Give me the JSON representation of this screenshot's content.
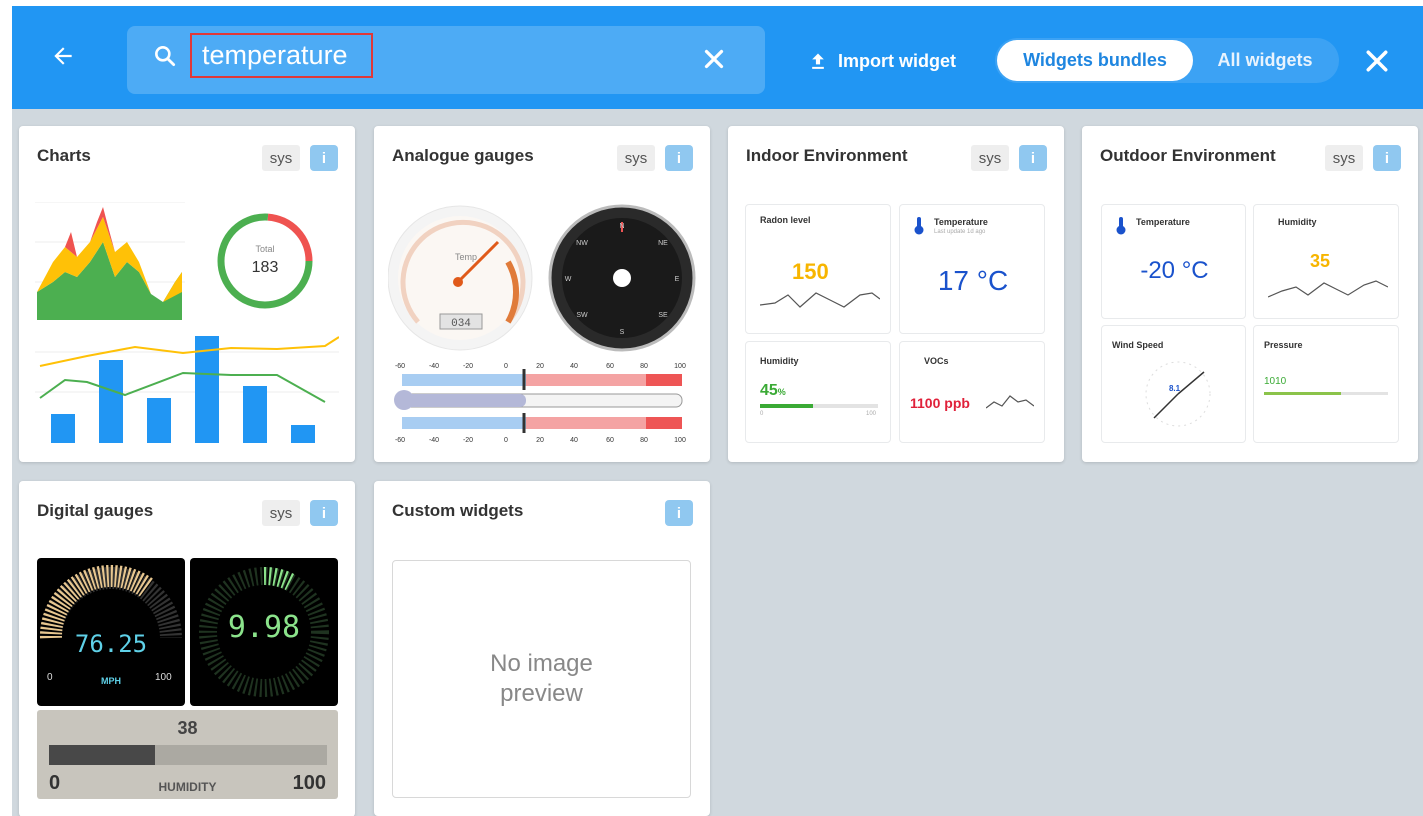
{
  "header": {
    "search_value": "temperature",
    "import_label": "Import widget",
    "toggle_active": "Widgets bundles",
    "toggle_inactive": "All widgets"
  },
  "icons": {
    "back": "arrow-left-icon",
    "search": "search-icon",
    "clear": "close-icon",
    "import": "upload-icon",
    "close": "close-icon"
  },
  "colors": {
    "header_bg": "#2196f3",
    "content_bg": "#d0d8de",
    "search_highlight": "#e03838",
    "info_badge": "#90c8f0"
  },
  "cards": [
    {
      "title": "Charts",
      "sys": "sys",
      "info": "i"
    },
    {
      "title": "Analogue gauges",
      "sys": "sys",
      "info": "i"
    },
    {
      "title": "Indoor Environment",
      "sys": "sys",
      "info": "i"
    },
    {
      "title": "Outdoor Environment",
      "sys": "sys",
      "info": "i"
    },
    {
      "title": "Digital gauges",
      "sys": "sys",
      "info": "i"
    },
    {
      "title": "Custom widgets",
      "info": "i",
      "no_preview": "No image preview"
    }
  ],
  "charts_preview": {
    "donut_label": "Total",
    "donut_value": "183"
  },
  "analogue_preview": {
    "gauge_label": "Temp",
    "gauge_readout": "034",
    "compass": [
      "N",
      "NE",
      "E",
      "SE",
      "S",
      "SW",
      "W",
      "NW"
    ],
    "scale": [
      "-60",
      "-40",
      "-20",
      "0",
      "20",
      "40",
      "60",
      "80",
      "100"
    ]
  },
  "indoor_preview": {
    "radon_label": "Radon level",
    "radon_value": "150",
    "temp_label": "Temperature",
    "temp_sub": "Last update 1d ago",
    "temp_value": "17 °C",
    "humidity_label": "Humidity",
    "humidity_value": "45",
    "humidity_unit": "%",
    "humidity_min": "0",
    "humidity_max": "100",
    "humidity_level": 0.45,
    "voc_label": "VOCs",
    "voc_value": "1100 ppb"
  },
  "outdoor_preview": {
    "temp_label": "Temperature",
    "temp_value": "-20 °C",
    "humidity_label": "Humidity",
    "humidity_value": "35",
    "wind_label": "Wind Speed",
    "wind_value": "8.1",
    "pressure_label": "Pressure",
    "pressure_value": "1010"
  },
  "digital_preview": {
    "speed_value": "76.25",
    "speed_unit": "MPH",
    "speed_min": "0",
    "speed_max": "100",
    "second_value": "9.98",
    "humidity_value": "38",
    "humidity_min": "0",
    "humidity_max": "100",
    "humidity_label": "HUMIDITY",
    "humidity_level": 0.38
  }
}
